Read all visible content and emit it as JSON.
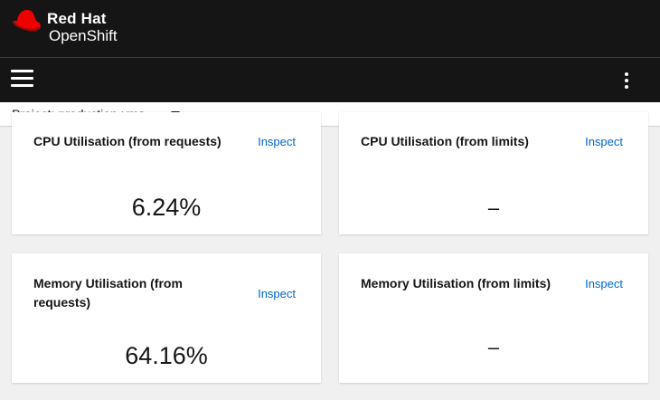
{
  "brand": {
    "name": "Red Hat",
    "product": "OpenShift",
    "logo_icon": "redhat-fedora-icon",
    "logo_color": "#ee0000"
  },
  "toolbar": {
    "menu_icon": "hamburger-icon",
    "more_icon": "kebab-icon"
  },
  "project": {
    "label": "Project:",
    "value": "production-vms",
    "icon": "caret-down-icon"
  },
  "cards": [
    {
      "title": "CPU Utilisation (from requests)",
      "action": "Inspect",
      "value": "6.24%"
    },
    {
      "title": "CPU Utilisation (from limits)",
      "action": "Inspect",
      "value": "–"
    },
    {
      "title": "Memory Utilisation (from requests)",
      "action": "Inspect",
      "value": "64.16%"
    },
    {
      "title": "Memory Utilisation (from limits)",
      "action": "Inspect",
      "value": "–"
    }
  ],
  "colors": {
    "masthead": "#151515",
    "link": "#0066cc",
    "background": "#f0f0f0"
  }
}
